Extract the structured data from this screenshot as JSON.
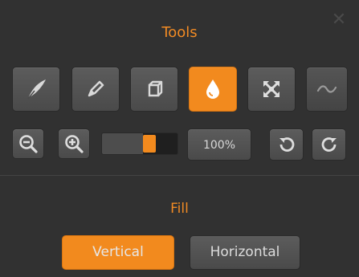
{
  "panel": {
    "title": "Tools",
    "close_icon": "close-icon"
  },
  "tools": [
    {
      "name": "feather-brush",
      "icon": "feather-icon",
      "active": false
    },
    {
      "name": "pencil",
      "icon": "pencil-icon",
      "active": false
    },
    {
      "name": "eraser",
      "icon": "eraser-icon",
      "active": false
    },
    {
      "name": "fill",
      "icon": "drop-icon",
      "active": true
    },
    {
      "name": "transform",
      "icon": "expand-arrows-icon",
      "active": false
    },
    {
      "name": "smudge",
      "icon": "tilde-icon",
      "active": false
    }
  ],
  "zoom": {
    "percent": "100%",
    "slider_value": 0.65
  },
  "fill": {
    "section_label": "Fill",
    "vertical_label": "Vertical",
    "horizontal_label": "Horizontal",
    "selected": "Vertical"
  },
  "colors": {
    "accent": "#f28a1e",
    "panel": "#313131"
  }
}
